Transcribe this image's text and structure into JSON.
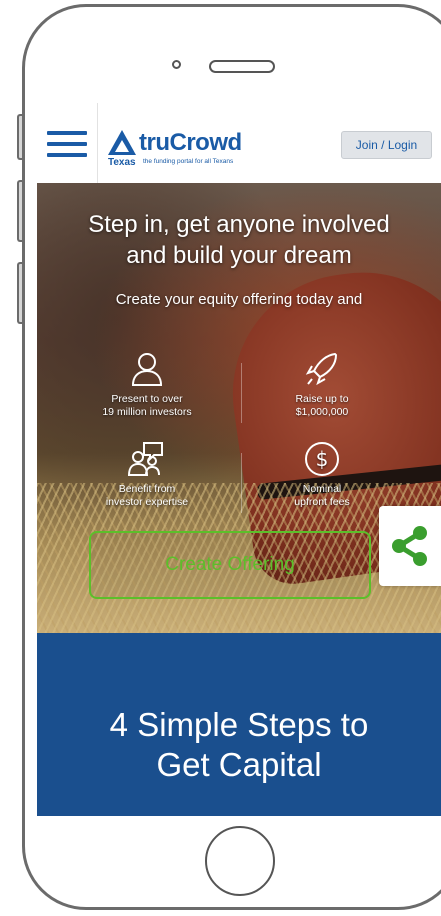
{
  "header": {
    "logo_name_part1": "tru",
    "logo_name_part2": "Crowd",
    "logo_region": "Texas",
    "logo_tagline": "the funding portal for all Texans",
    "join_label": "Join / Login"
  },
  "hero": {
    "title_line1": "Step in, get anyone involved",
    "title_line2": "and build your dream",
    "subtitle": "Create your equity offering today and",
    "features": [
      {
        "icon": "person-icon",
        "line1": "Present to over",
        "line2": "19 million investors"
      },
      {
        "icon": "rocket-icon",
        "line1": "Raise up to",
        "line2": "$1,000,000"
      },
      {
        "icon": "chat-people-icon",
        "line1": "Benefit from",
        "line2": "investor expertise"
      },
      {
        "icon": "dollar-coin-icon",
        "line1": "Nominal",
        "line2": "upfront fees"
      }
    ],
    "cta_label": "Create Offering",
    "share_icon": "share-icon"
  },
  "steps": {
    "title_line1": "4 Simple Steps to",
    "title_line2": "Get Capital"
  },
  "colors": {
    "brand_blue": "#1a5ba6",
    "section_blue": "#1a4f8e",
    "cta_green": "#5cbf2a"
  }
}
